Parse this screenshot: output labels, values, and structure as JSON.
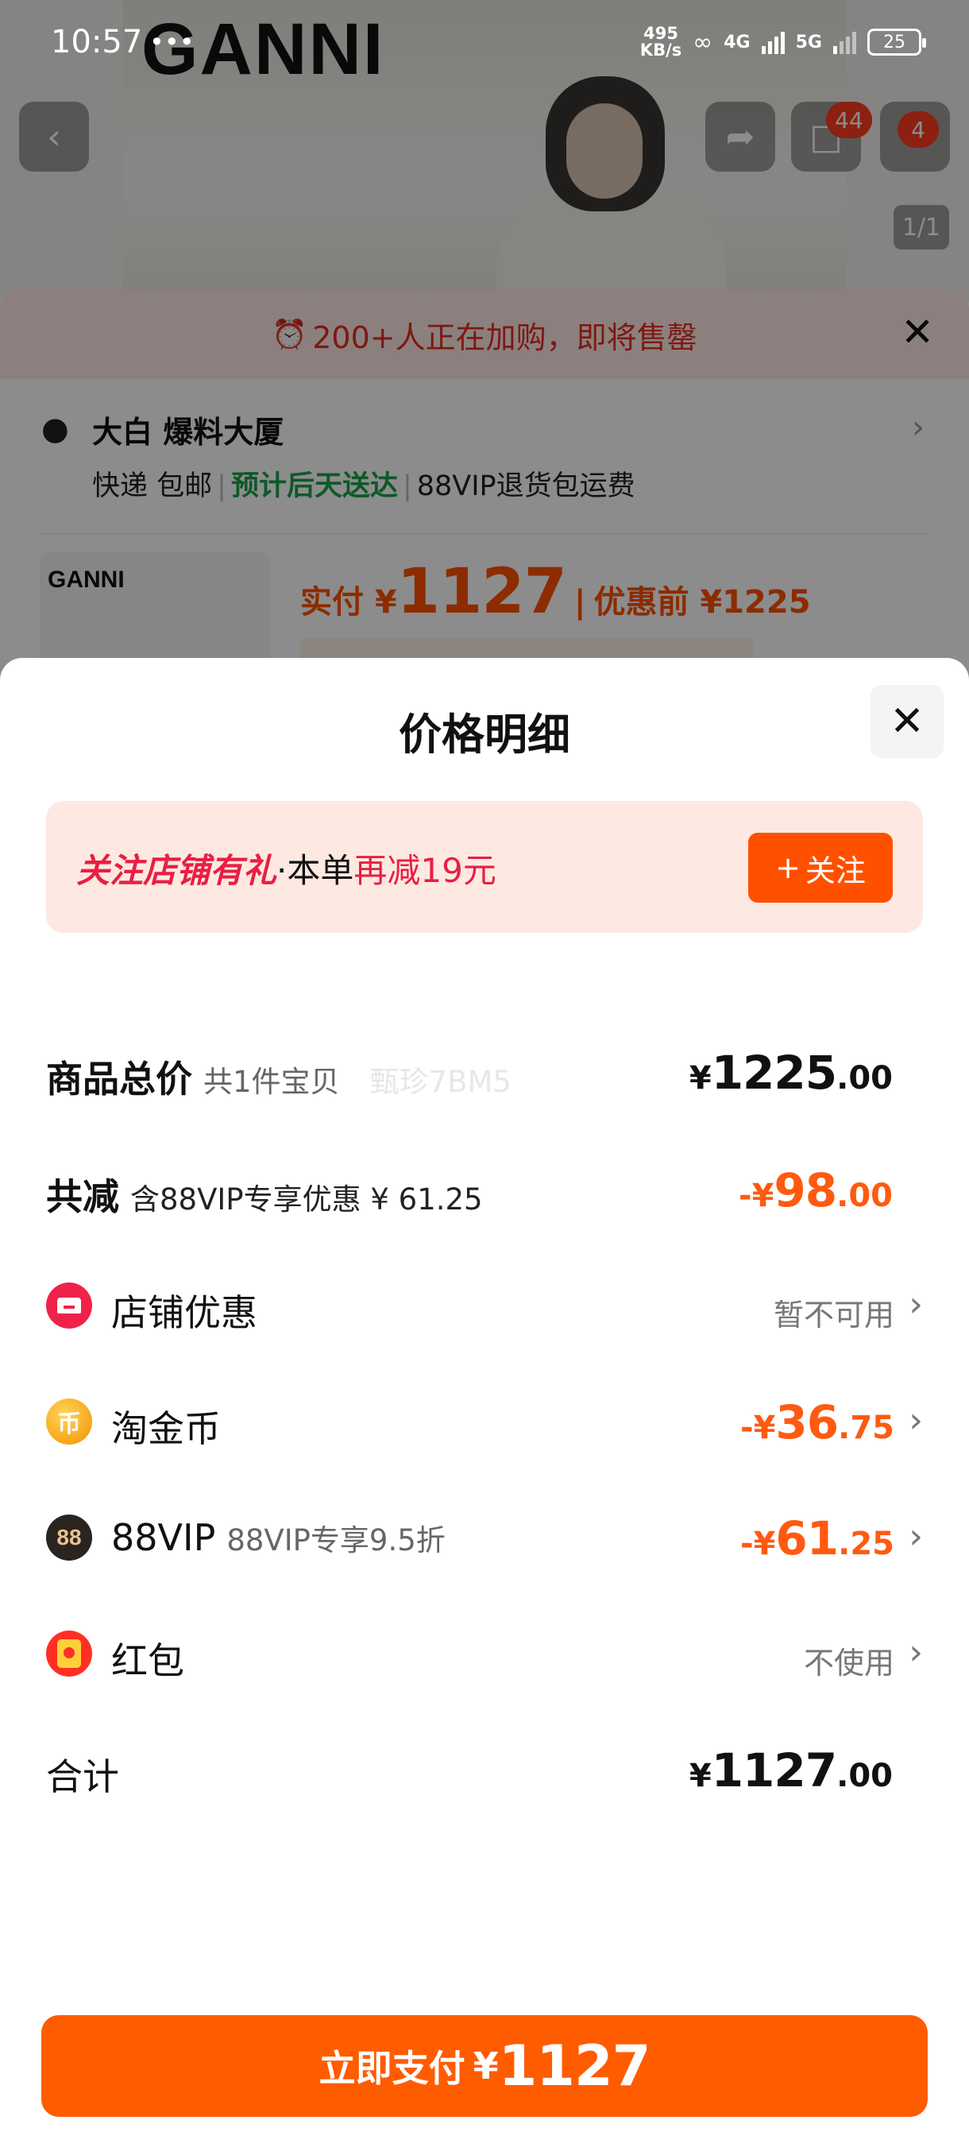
{
  "status_bar": {
    "time": "10:57",
    "notif_icons": "•••",
    "net_speed_value": "495",
    "net_speed_unit": "KB/s",
    "network_1": "4G",
    "network_2": "5G",
    "battery": "25"
  },
  "background": {
    "brand": "GANNI",
    "cart_badge": "44",
    "more_badge": "4",
    "image_counter": "1/1",
    "urgency": "200+人正在加购，即将售罄",
    "address_name": "大白 爆料大厦",
    "shipping_method": "快递 包邮",
    "delivery_estimate": "预计后天送达",
    "return_shipping": "88VIP退货包运费",
    "thumb_brand": "GANNI",
    "pay_label": "实付 ¥",
    "pay_amount": "1127",
    "pre_discount_label": "优惠前 ¥1225"
  },
  "sheet": {
    "title": "价格明细",
    "follow_banner": {
      "highlight": "关注店铺有礼",
      "middle": "·本单",
      "discount": "再减19元",
      "button": "关注"
    },
    "rows": {
      "total": {
        "label": "商品总价",
        "sub": "共1件宝贝",
        "ghost": "甄珍7BM5",
        "yen": "¥",
        "int": "1225",
        "dec": ".00"
      },
      "reduce": {
        "label": "共减",
        "sub": "含88VIP专享优惠 ¥ 61.25",
        "yen": "-¥",
        "int": "98",
        "dec": ".00"
      },
      "store": {
        "label": "店铺优惠",
        "value": "暂不可用"
      },
      "coin": {
        "label": "淘金币",
        "icon_text": "币",
        "yen": "-¥",
        "int": "36",
        "dec": ".75"
      },
      "vip": {
        "label": "88VIP",
        "icon_text": "88",
        "sub": "88VIP专享9.5折",
        "yen": "-¥",
        "int": "61",
        "dec": ".25"
      },
      "redpacket": {
        "label": "红包",
        "value": "不使用"
      },
      "sum": {
        "label": "合计",
        "yen": "¥",
        "int": "1127",
        "dec": ".00"
      }
    },
    "pay_button": {
      "label": "立即支付",
      "yen": "¥",
      "amount": "1127"
    }
  },
  "colors": {
    "accent_orange": "#ff5000",
    "highlight_red": "#e91e43",
    "delivery_green": "#19a14a"
  },
  "icons": [
    "back-icon",
    "share-icon",
    "cart-icon",
    "more-icon",
    "location-pin-icon",
    "alarm-clock-icon",
    "close-icon",
    "chevron-right-icon",
    "store-icon",
    "gold-coin-icon",
    "vip-88-icon",
    "red-packet-icon",
    "plus-icon"
  ]
}
